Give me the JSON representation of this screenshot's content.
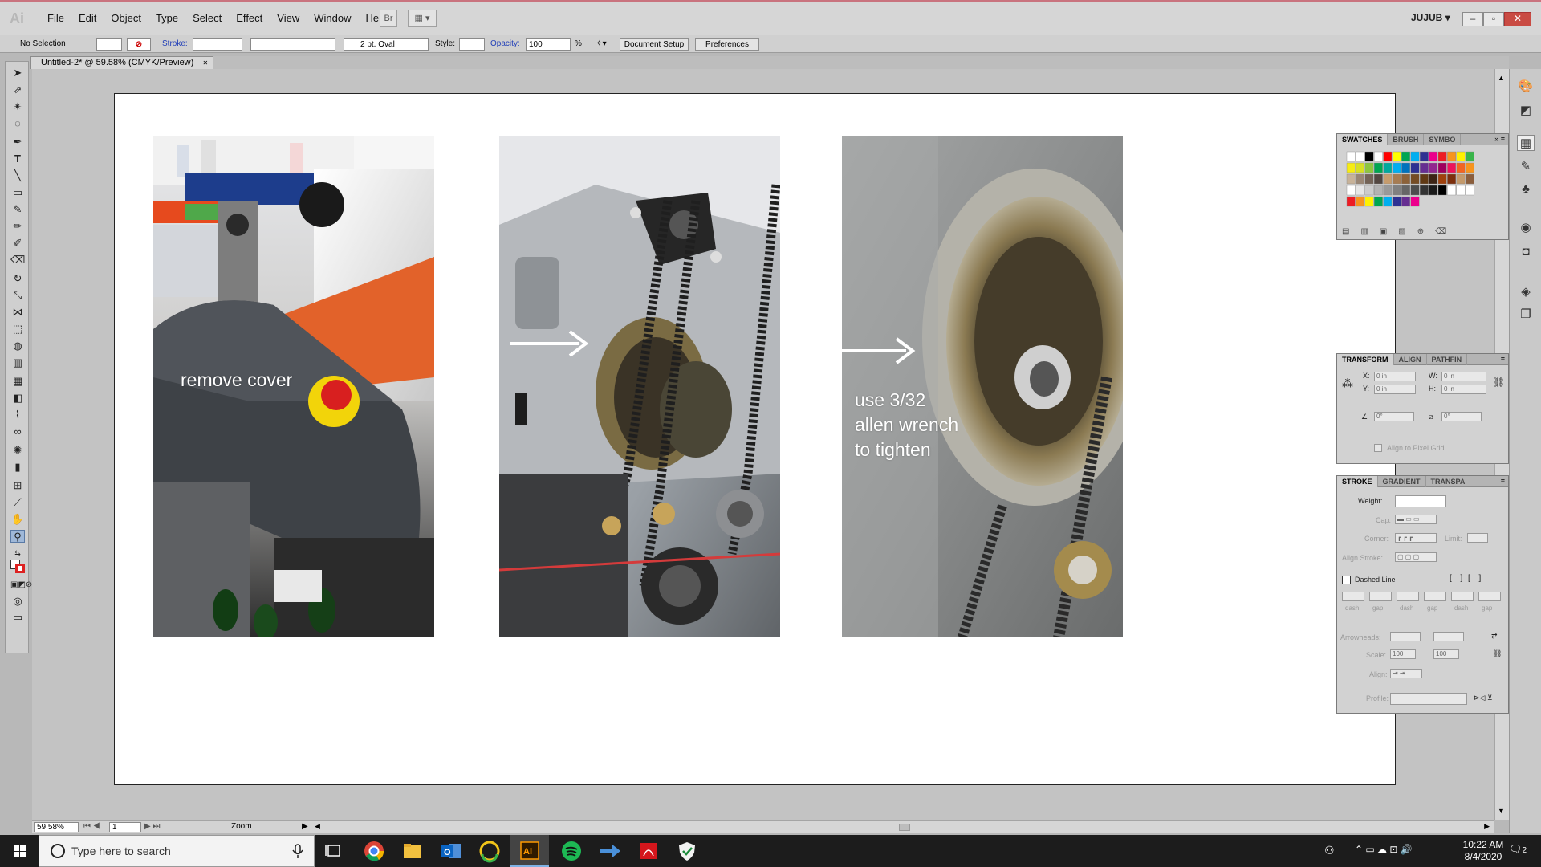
{
  "app": {
    "logo": "Ai",
    "workspace": "JUJUB"
  },
  "menu": [
    "File",
    "Edit",
    "Object",
    "Type",
    "Select",
    "Effect",
    "View",
    "Window",
    "Help"
  ],
  "menubar_buttons": {
    "bridge": "Br"
  },
  "control": {
    "selection": "No Selection",
    "stroke_label": "Stroke:",
    "brush_value": "2 pt. Oval",
    "style_label": "Style:",
    "opacity_label": "Opacity:",
    "opacity_value": "100",
    "opacity_unit": "%",
    "document_setup": "Document Setup",
    "preferences": "Preferences"
  },
  "document": {
    "tab_title": "Untitled-2* @ 59.58% (CMYK/Preview)"
  },
  "captions": {
    "photo1": "remove cover",
    "photo3": "use 3/32\nallen wrench\nto tighten"
  },
  "statusbar": {
    "zoom": "59.58%",
    "artboard": "1",
    "mode": "Zoom"
  },
  "swatches_panel": {
    "tabs": [
      "SWATCHES",
      "BRUSH",
      "SYMBO"
    ]
  },
  "transform_panel": {
    "tabs": [
      "TRANSFORM",
      "ALIGN",
      "PATHFIN"
    ],
    "x_label": "X:",
    "x": "0 in",
    "y_label": "Y:",
    "y": "0 in",
    "w_label": "W:",
    "w": "0 in",
    "h_label": "H:",
    "h": "0 in",
    "rotate": "0°",
    "shear": "0°",
    "align_pixel": "Align to Pixel Grid"
  },
  "stroke_panel": {
    "tabs": [
      "STROKE",
      "GRADIENT",
      "TRANSPA"
    ],
    "weight": "Weight:",
    "cap": "Cap:",
    "corner": "Corner:",
    "limit": "Limit:",
    "align_stroke": "Align Stroke:",
    "dashed_line": "Dashed Line",
    "dash_labels": [
      "dash",
      "gap",
      "dash",
      "gap",
      "dash",
      "gap"
    ],
    "arrowheads": "Arrowheads:",
    "scale": "Scale:",
    "scale1": "100",
    "scale2": "100",
    "align": "Align:",
    "profile": "Profile:"
  },
  "taskbar": {
    "search_placeholder": "Type here to search",
    "time": "10:22 AM",
    "date": "8/4/2020",
    "notifications": "2"
  },
  "colors": {
    "menubar_accent": "#c9737e",
    "taskbar": "#1c1c1c",
    "illustrator": "#ff9a00"
  }
}
